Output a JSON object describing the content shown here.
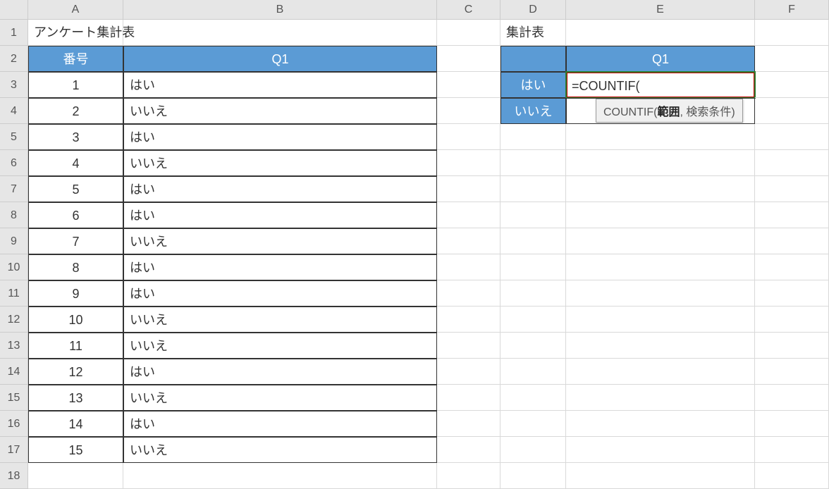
{
  "columns": [
    "A",
    "B",
    "C",
    "D",
    "E",
    "F"
  ],
  "table1": {
    "title": "アンケート集計表",
    "headers": {
      "col1": "番号",
      "col2": "Q1"
    },
    "rows": [
      {
        "num": "1",
        "ans": "はい"
      },
      {
        "num": "2",
        "ans": "いいえ"
      },
      {
        "num": "3",
        "ans": "はい"
      },
      {
        "num": "4",
        "ans": "いいえ"
      },
      {
        "num": "5",
        "ans": "はい"
      },
      {
        "num": "6",
        "ans": "はい"
      },
      {
        "num": "7",
        "ans": "いいえ"
      },
      {
        "num": "8",
        "ans": "はい"
      },
      {
        "num": "9",
        "ans": "はい"
      },
      {
        "num": "10",
        "ans": "いいえ"
      },
      {
        "num": "11",
        "ans": "いいえ"
      },
      {
        "num": "12",
        "ans": "はい"
      },
      {
        "num": "13",
        "ans": "いいえ"
      },
      {
        "num": "14",
        "ans": "はい"
      },
      {
        "num": "15",
        "ans": "いいえ"
      }
    ]
  },
  "table2": {
    "title": "集計表",
    "header": "Q1",
    "labels": {
      "yes": "はい",
      "no": "いいえ"
    },
    "formula": "=COUNTIF("
  },
  "tooltip": {
    "func": "COUNTIF(",
    "arg1": "範囲",
    "sep": ", ",
    "arg2": "検索条件)"
  },
  "rowNumbers": [
    "1",
    "2",
    "3",
    "4",
    "5",
    "6",
    "7",
    "8",
    "9",
    "10",
    "11",
    "12",
    "13",
    "14",
    "15",
    "16",
    "17",
    "18"
  ]
}
